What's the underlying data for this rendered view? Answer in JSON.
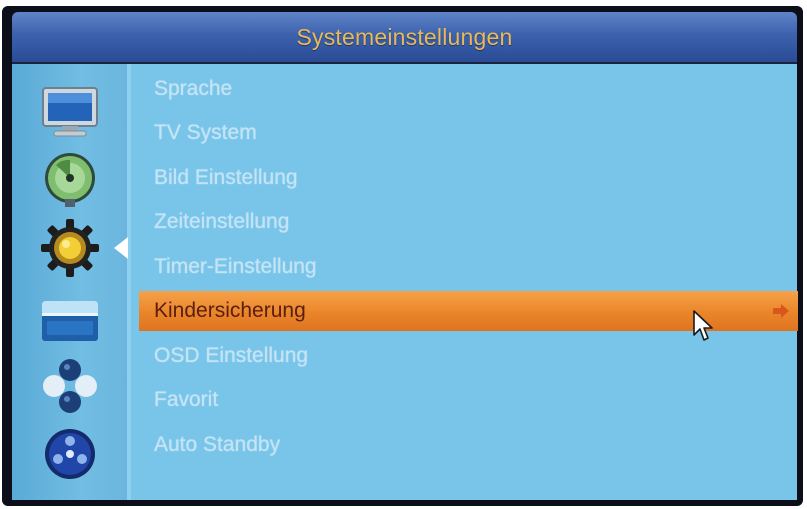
{
  "header": {
    "title": "Systemeinstellungen"
  },
  "sidebar": {
    "icons": [
      {
        "name": "tv-icon"
      },
      {
        "name": "satellite-dish-icon"
      },
      {
        "name": "gear-icon"
      },
      {
        "name": "toolbox-icon"
      },
      {
        "name": "games-icon"
      },
      {
        "name": "media-icon"
      }
    ],
    "active_index": 2
  },
  "menu": {
    "items": [
      "Sprache",
      "TV System",
      "Bild Einstellung",
      "Zeiteinstellung",
      "Timer-Einstellung",
      "Kindersicherung",
      "OSD Einstellung",
      "Favorit",
      "Auto Standby"
    ],
    "selected_index": 5
  },
  "colors": {
    "title_text": "#e7b95a",
    "highlight": "#ea8529",
    "content_bg": "#79c5ea",
    "header_bg": "#3d62ad"
  }
}
